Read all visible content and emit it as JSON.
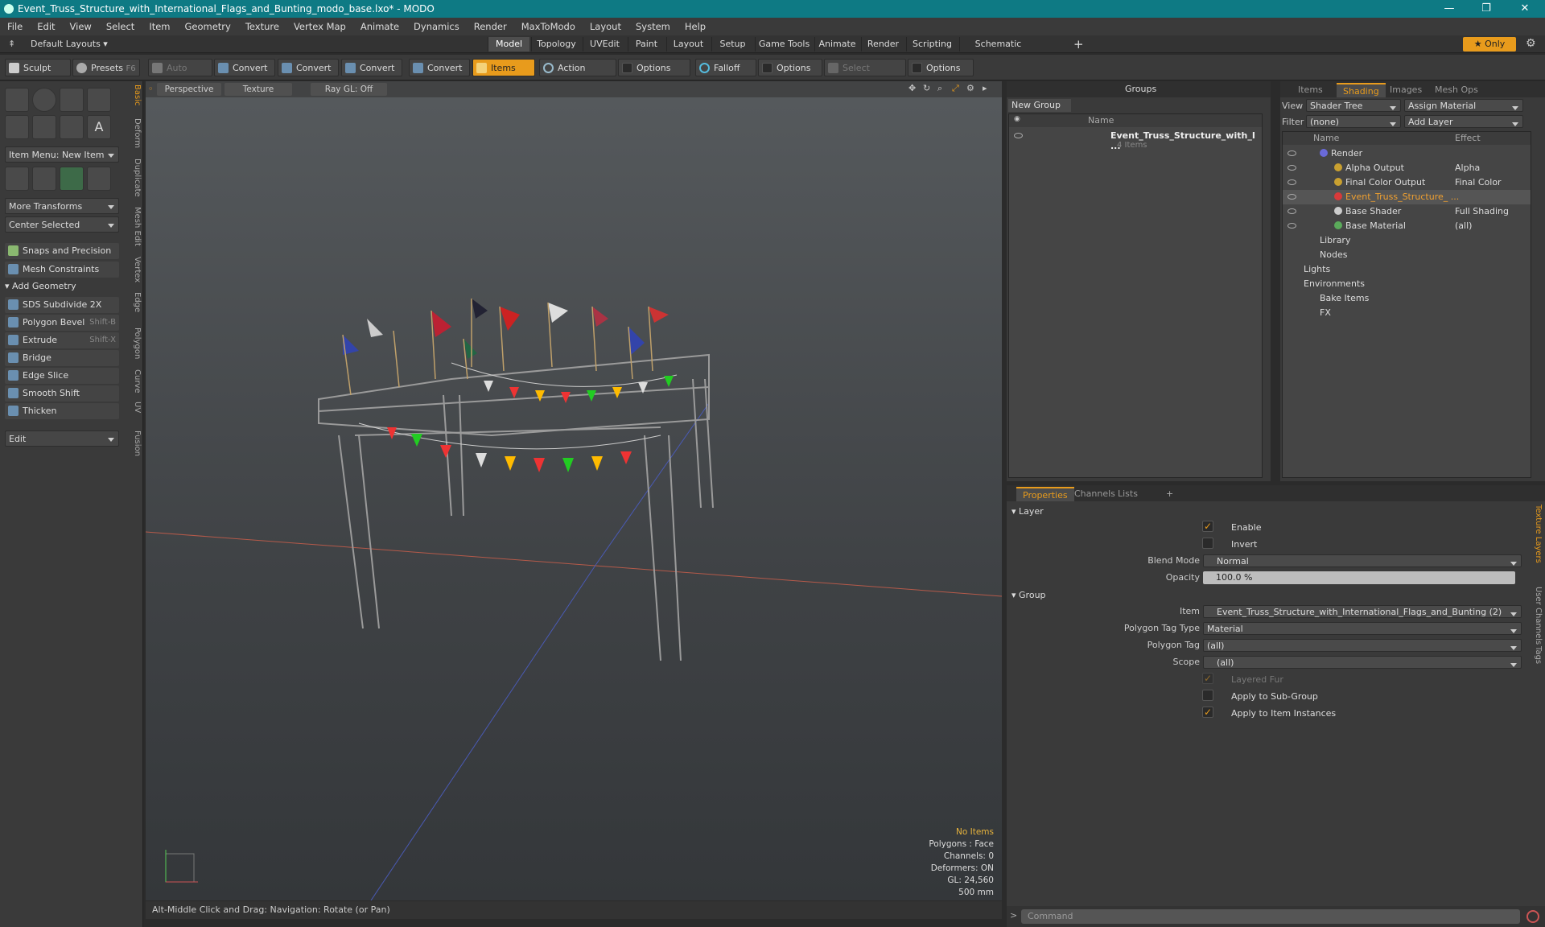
{
  "title": "Event_Truss_Structure_with_International_Flags_and_Bunting_modo_base.lxo* - MODO",
  "window": {
    "minimize": "—",
    "restore": "❐",
    "close": "✕"
  },
  "menu": [
    "File",
    "Edit",
    "View",
    "Select",
    "Item",
    "Geometry",
    "Texture",
    "Vertex Map",
    "Animate",
    "Dynamics",
    "Render",
    "MaxToModo",
    "Layout",
    "System",
    "Help"
  ],
  "layout": {
    "label": "Default Layouts ▾",
    "tabs": [
      "Model",
      "Topology",
      "UVEdit",
      "Paint",
      "Layout",
      "Setup",
      "Game Tools",
      "Animate",
      "Render",
      "Scripting",
      "Schematic Fusion"
    ],
    "add": "+",
    "only": "★  Only",
    "gear": "⚙"
  },
  "toolbar": {
    "sculpt": "Sculpt",
    "presets": "Presets",
    "presets_key": "F6",
    "auto_select": "Auto Select",
    "convert": "Convert",
    "items": "Items",
    "action_center": "Action Center",
    "options": "Options",
    "falloff": "Falloff",
    "select_through": "Select Through"
  },
  "left": {
    "item_menu": "Item Menu: New Item",
    "more_transforms": "More Transforms",
    "center_selected": "Center Selected",
    "snaps": "Snaps and Precision",
    "mesh_constraints": "Mesh Constraints",
    "add_geometry": "Add Geometry",
    "tools": [
      {
        "label": "SDS Subdivide 2X",
        "key": ""
      },
      {
        "label": "Polygon Bevel",
        "key": "Shift-B"
      },
      {
        "label": "Extrude",
        "key": "Shift-X"
      },
      {
        "label": "Bridge",
        "key": ""
      },
      {
        "label": "Edge Slice",
        "key": ""
      },
      {
        "label": "Smooth Shift",
        "key": ""
      },
      {
        "label": "Thicken",
        "key": ""
      }
    ],
    "edit": "Edit",
    "vtabs": [
      "Basic",
      "Deform",
      "Duplicate",
      "Mesh Edit",
      "Vertex",
      "Edge",
      "Polygon",
      "Curve",
      "UV",
      "Fusion"
    ]
  },
  "viewport": {
    "perspective": "Perspective",
    "texture": "Texture",
    "raygl": "Ray GL: Off",
    "info": {
      "no_items": "No Items",
      "polygons": "Polygons : Face",
      "channels": "Channels: 0",
      "deformers": "Deformers: ON",
      "gl": "GL: 24,560",
      "scale": "500 mm"
    }
  },
  "status": "Alt-Middle Click and Drag:   Navigation: Rotate (or Pan)",
  "groups": {
    "title": "Groups",
    "new_group": "New Group",
    "name_col": "Name",
    "item": "Event_Truss_Structure_with_I ...",
    "count": "4 Items"
  },
  "shading": {
    "tabs": [
      "Items",
      "Shading",
      "Images",
      "Mesh Ops"
    ],
    "view_label": "View",
    "view_value": "Shader Tree",
    "assign": "Assign Material",
    "filter_label": "Filter",
    "filter_value": "(none)",
    "add_layer": "Add Layer",
    "name_col": "Name",
    "effect_col": "Effect",
    "rows": [
      {
        "label": "Render",
        "effect": ""
      },
      {
        "label": "Alpha Output",
        "effect": "Alpha"
      },
      {
        "label": "Final Color Output",
        "effect": "Final Color"
      },
      {
        "label": "Event_Truss_Structure_ ...",
        "effect": ""
      },
      {
        "label": "Base Shader",
        "effect": "Full Shading"
      },
      {
        "label": "Base Material",
        "effect": "(all)"
      },
      {
        "label": "Library",
        "effect": ""
      },
      {
        "label": "Nodes",
        "effect": ""
      },
      {
        "label": "Lights",
        "effect": ""
      },
      {
        "label": "Environments",
        "effect": ""
      },
      {
        "label": "Bake Items",
        "effect": ""
      },
      {
        "label": "FX",
        "effect": ""
      }
    ]
  },
  "props": {
    "tabs": [
      "Properties",
      "Channels",
      "Lists"
    ],
    "layer": "Layer",
    "enable": "Enable",
    "invert": "Invert",
    "blend_mode_label": "Blend Mode",
    "blend_mode": "Normal",
    "opacity_label": "Opacity",
    "opacity": "100.0 %",
    "group": "Group",
    "item_label": "Item",
    "item": "Event_Truss_Structure_with_International_Flags_and_Bunting (2)",
    "ptt_label": "Polygon Tag Type",
    "ptt": "Material",
    "pt_label": "Polygon Tag",
    "pt": "(all)",
    "scope_label": "Scope",
    "scope": "(all)",
    "layered_fur": "Layered Fur",
    "apply_sub": "Apply to Sub-Group",
    "apply_inst": "Apply to Item Instances",
    "side_tabs": [
      "Texture Layers",
      "User Channels",
      "Tags"
    ]
  },
  "command": "Command"
}
